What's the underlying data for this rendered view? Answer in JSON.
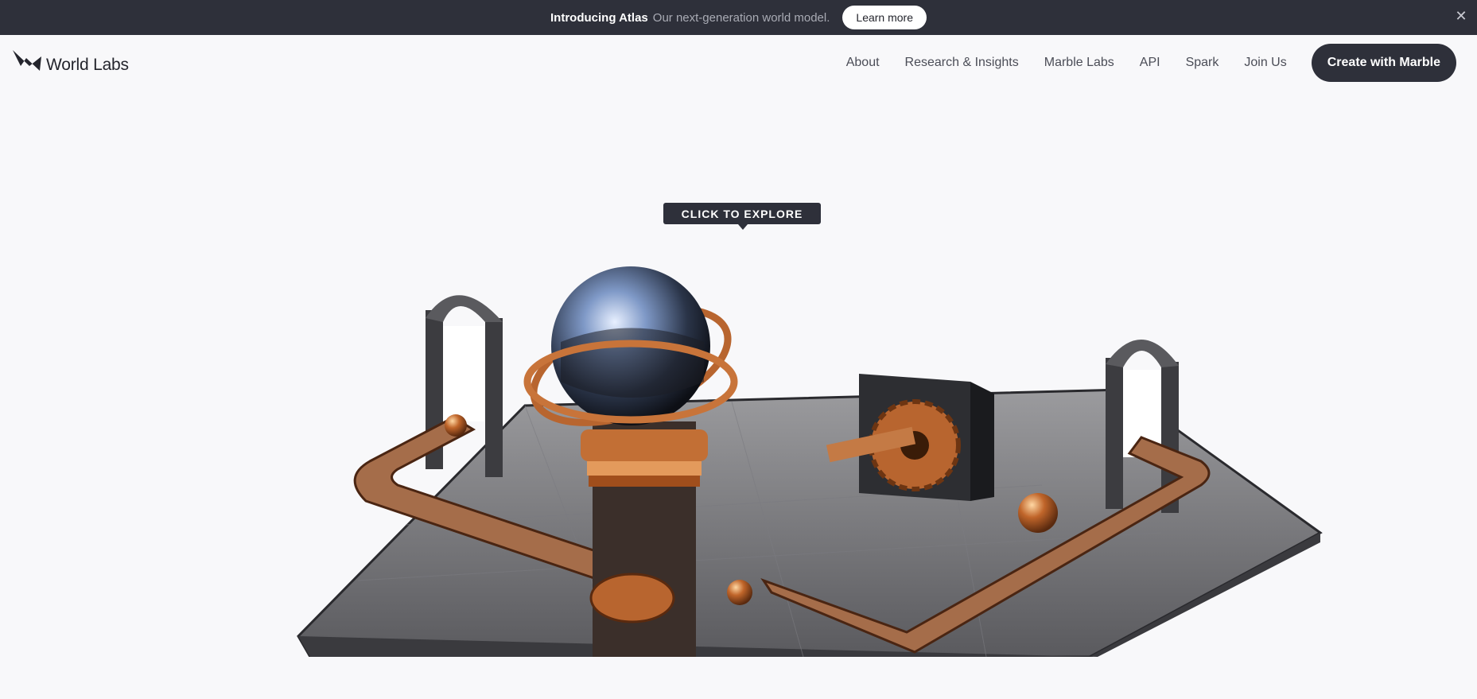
{
  "announcement": {
    "title": "Introducing Atlas",
    "subtitle": "Our next-generation world model.",
    "cta_label": "Learn more",
    "close_symbol": "✕"
  },
  "header": {
    "brand": "World Labs",
    "nav": [
      "About",
      "Research & Insights",
      "Marble Labs",
      "API",
      "Spark",
      "Join Us"
    ],
    "cta_label": "Create with Marble"
  },
  "hero": {
    "tooltip": "CLICK TO EXPLORE"
  },
  "colors": {
    "dark": "#2e303a",
    "copper": "#b8652f",
    "background": "#f8f8fa"
  },
  "icons": [
    "close-icon",
    "world-labs-logo-icon"
  ]
}
